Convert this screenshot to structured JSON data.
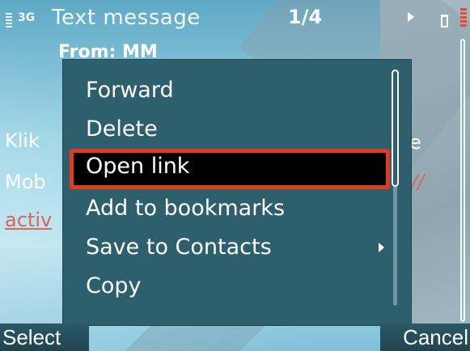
{
  "status_bar": {
    "network": "3G",
    "title": "Text message",
    "counter": "1/4",
    "play_icon": "play-icon",
    "battery_icon": "battery-icon"
  },
  "message": {
    "from": "From: MM",
    "line1": "Klik",
    "line2": "Mob",
    "link_fragment": "activ",
    "right_fragment1": "e",
    "right_fragment2": "//"
  },
  "menu": {
    "items": [
      {
        "label": "Forward"
      },
      {
        "label": "Delete"
      },
      {
        "label": "Open link"
      },
      {
        "label": "Add to bookmarks"
      },
      {
        "label": "Save to Contacts"
      },
      {
        "label": "Copy"
      }
    ],
    "selected_index": 2,
    "submenu_item_index": 4
  },
  "softkeys": {
    "left": "Select",
    "right": "Cancel"
  },
  "colors": {
    "highlight_border": "#e23a1e",
    "popup_bg": "#2e5f6c",
    "link": "#d9665a"
  }
}
